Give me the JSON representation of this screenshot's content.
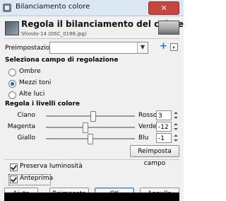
{
  "window": {
    "title": "Bilanciamento colore",
    "close_label": "✕"
  },
  "header": {
    "title": "Regola il bilanciamento del colore",
    "subtitle": "Sfondo-14 (DSC_0198.jpg)"
  },
  "presets": {
    "label": "Preimpostazioni:",
    "value": "",
    "add_icon": "plus-icon",
    "menu_icon": "menu-triangle-icon"
  },
  "range": {
    "title": "Seleziona campo di regolazione",
    "options": [
      {
        "label": "Ombre",
        "selected": false
      },
      {
        "label": "Mezzi toni",
        "selected": true
      },
      {
        "label": "Alte luci",
        "selected": false
      }
    ]
  },
  "levels": {
    "title": "Regola i livelli colore",
    "rows": [
      {
        "left": "Ciano",
        "right": "Rosso",
        "value": "3",
        "fraction": 0.52
      },
      {
        "left": "Magenta",
        "right": "Verde",
        "value": "-12",
        "fraction": 0.44
      },
      {
        "left": "Giallo",
        "right": "Blu",
        "value": "-1",
        "fraction": 0.49
      }
    ],
    "reset_range_label": "Reimposta campo"
  },
  "options": {
    "preserve_luminosity": {
      "label": "Preserva luminosità",
      "checked": true
    },
    "preview": {
      "label": "Anteprima",
      "checked": true
    }
  },
  "buttons": {
    "help": "Aiuto",
    "reset": "Reimposta",
    "ok": "OK",
    "cancel": "Annulla"
  }
}
